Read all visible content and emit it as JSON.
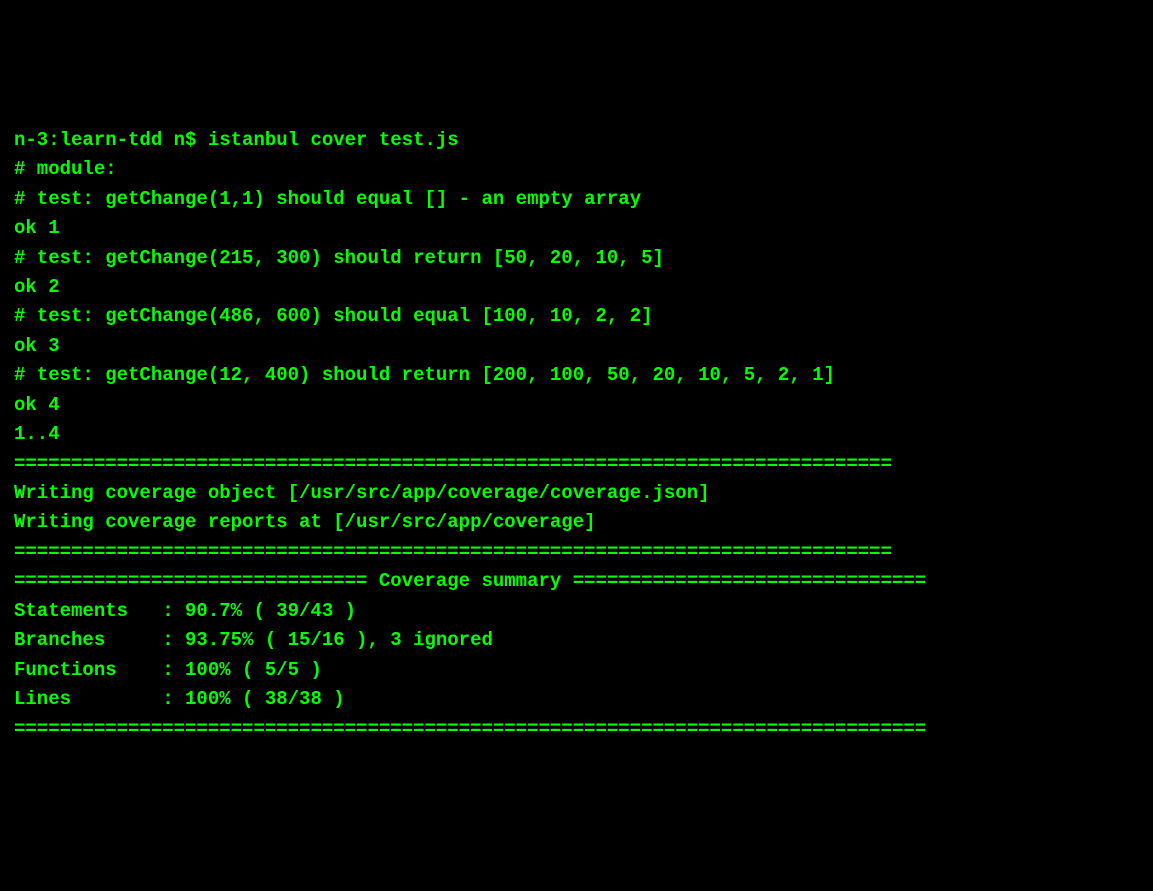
{
  "terminal": {
    "prompt_line": "n-3:learn-tdd n$ istanbul cover test.js",
    "lines": [
      "# module:",
      "# test: getChange(1,1) should equal [] - an empty array",
      "ok 1",
      "# test: getChange(215, 300) should return [50, 20, 10, 5]",
      "ok 2",
      "# test: getChange(486, 600) should equal [100, 10, 2, 2]",
      "ok 3",
      "# test: getChange(12, 400) should return [200, 100, 50, 20, 10, 5, 2, 1]",
      "ok 4",
      "1..4",
      "=============================================================================",
      "Writing coverage object [/usr/src/app/coverage/coverage.json]",
      "Writing coverage reports at [/usr/src/app/coverage]",
      "=============================================================================",
      "",
      "=============================== Coverage summary ===============================",
      "Statements   : 90.7% ( 39/43 )",
      "Branches     : 93.75% ( 15/16 ), 3 ignored",
      "Functions    : 100% ( 5/5 )",
      "Lines        : 100% ( 38/38 )",
      "================================================================================"
    ]
  }
}
